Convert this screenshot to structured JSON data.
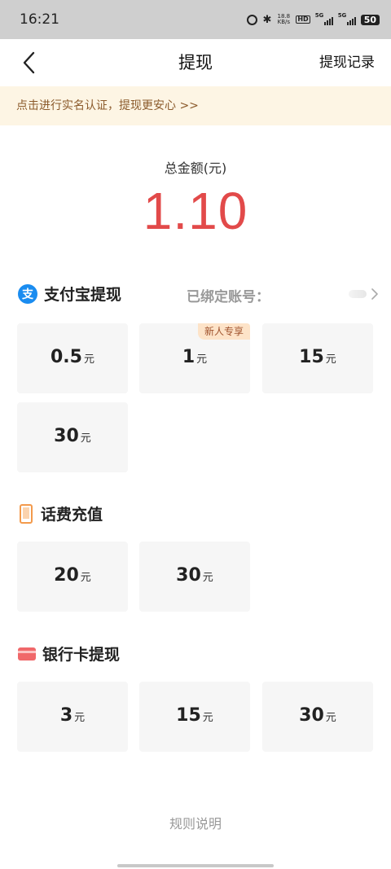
{
  "status_bar": {
    "time": "16:21",
    "network_speed": "18.8",
    "network_speed_unit": "KB/s",
    "hd_label": "HD",
    "signal1_label": "5G",
    "signal2_label": "5G",
    "battery": "50"
  },
  "header": {
    "title": "提现",
    "record_link": "提现记录"
  },
  "banner": {
    "text": "点击进行实名认证，提现更安心 >>"
  },
  "total": {
    "label": "总金额(元)",
    "amount": "1.10"
  },
  "alipay": {
    "icon_char": "支",
    "title": "支付宝提现",
    "bound_label": "已绑定账号：",
    "options": [
      {
        "amount": "0.5",
        "unit": "元"
      },
      {
        "amount": "1",
        "unit": "元",
        "tag": "新人专享"
      },
      {
        "amount": "15",
        "unit": "元"
      },
      {
        "amount": "30",
        "unit": "元"
      }
    ]
  },
  "phone": {
    "title": "话费充值",
    "options": [
      {
        "amount": "20",
        "unit": "元"
      },
      {
        "amount": "30",
        "unit": "元"
      }
    ]
  },
  "bank": {
    "title": "银行卡提现",
    "options": [
      {
        "amount": "3",
        "unit": "元"
      },
      {
        "amount": "15",
        "unit": "元"
      },
      {
        "amount": "30",
        "unit": "元"
      }
    ]
  },
  "footer": {
    "rules_link": "规则说明"
  },
  "colors": {
    "amount_red": "#e24a4a",
    "banner_bg": "#fdf5e4",
    "banner_text": "#8b5a2b",
    "alipay_blue": "#1a8cf0",
    "phone_orange": "#f39a4c",
    "card_red": "#f0686a",
    "tag_bg": "#fde3c8"
  }
}
